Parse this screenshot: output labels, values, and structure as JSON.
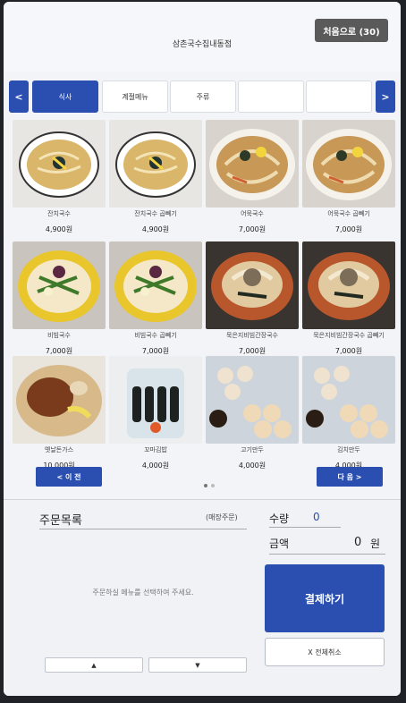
{
  "header": {
    "store_name": "삼촌국수집내동점",
    "home_button": "처음으로 (30)"
  },
  "tabs": {
    "prev": "<",
    "next": ">",
    "items": [
      {
        "label": "식사",
        "active": true
      },
      {
        "label": "계절메뉴",
        "active": false
      },
      {
        "label": "주류",
        "active": false
      },
      {
        "label": "",
        "active": false
      },
      {
        "label": "",
        "active": false
      }
    ]
  },
  "menu": {
    "items": [
      {
        "name": "잔치국수",
        "price": "4,900원",
        "icon": "noodle-soup-image"
      },
      {
        "name": "잔치국수 곱빼기",
        "price": "4,900원",
        "icon": "noodle-soup-image"
      },
      {
        "name": "어묵국수",
        "price": "7,000원",
        "icon": "fishcake-noodle-image"
      },
      {
        "name": "어묵국수 곱빼기",
        "price": "7,000원",
        "icon": "fishcake-noodle-image"
      },
      {
        "name": "비빔국수",
        "price": "7,000원",
        "icon": "bibim-noodle-image"
      },
      {
        "name": "비빔국수 곱빼기",
        "price": "7,000원",
        "icon": "bibim-noodle-image"
      },
      {
        "name": "묵은지비빔간장국수",
        "price": "7,000원",
        "icon": "soy-noodle-image"
      },
      {
        "name": "묵은지비빔간장국수 곱빼기",
        "price": "7,000원",
        "icon": "soy-noodle-image"
      },
      {
        "name": "옛날돈가스",
        "price": "10,000원",
        "icon": "pork-cutlet-image"
      },
      {
        "name": "꼬마김밥",
        "price": "4,000원",
        "icon": "kimbap-image"
      },
      {
        "name": "고기만두",
        "price": "4,000원",
        "icon": "dumpling-image"
      },
      {
        "name": "김치만두",
        "price": "4,000원",
        "icon": "dumpling-image"
      }
    ]
  },
  "pager": {
    "prev": "< 이 전",
    "next": "다 음 >"
  },
  "order": {
    "title": "주문목록",
    "type": "(매장주문)",
    "empty_message": "주문하실 메뉴를 선택하여 주세요.",
    "qty_label": "수량",
    "qty_value": "0",
    "amount_label": "금액",
    "amount_value": "0",
    "amount_unit": "원",
    "pay_button": "결제하기",
    "cancel_button": "X 전체취소",
    "scroll_up": "▲",
    "scroll_down": "▼"
  },
  "colors": {
    "accent": "#2a4fb0",
    "home_button": "#5a5a5a"
  }
}
